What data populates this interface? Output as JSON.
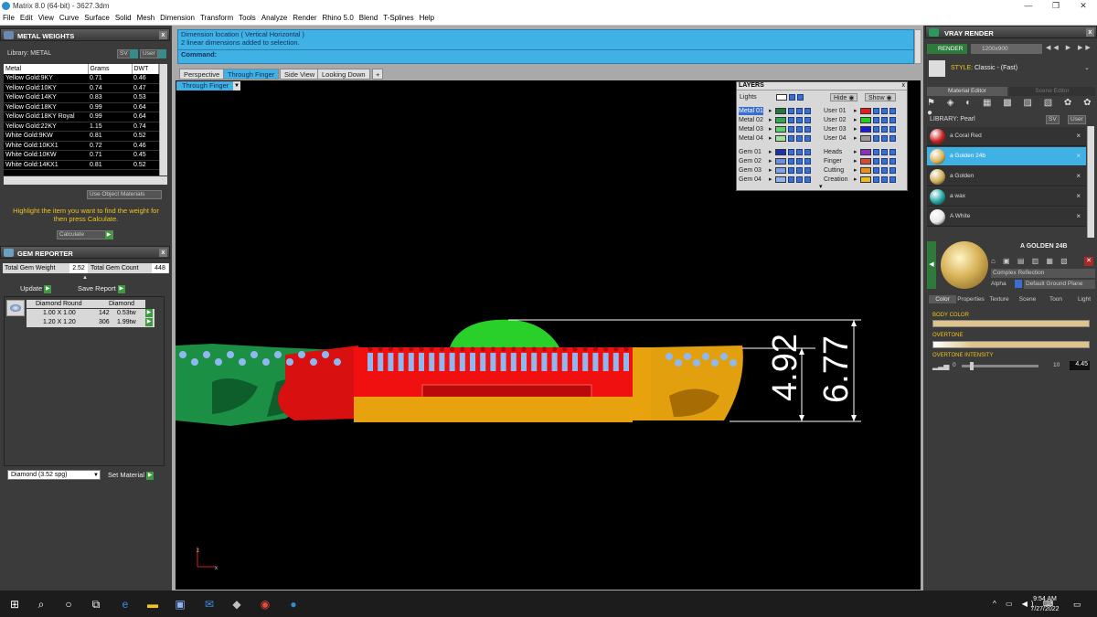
{
  "window": {
    "title": "Matrix 8.0 (64-bit) - 3627.3dm"
  },
  "menu": [
    "File",
    "Edit",
    "View",
    "Curve",
    "Surface",
    "Solid",
    "Mesh",
    "Dimension",
    "Transform",
    "Tools",
    "Analyze",
    "Render",
    "Rhino 5.0",
    "Blend",
    "T-Splines",
    "Help"
  ],
  "metal_weights": {
    "title": "METAL WEIGHTS",
    "library_label": "Library: METAL",
    "sv_label": "SV",
    "user_label": "User",
    "headers": [
      "Metal",
      "Grams",
      "DWT"
    ],
    "rows": [
      [
        "Yellow Gold:9KY",
        "0.71",
        "0.46"
      ],
      [
        "Yellow Gold:10KY",
        "0.74",
        "0.47"
      ],
      [
        "Yellow Gold:14KY",
        "0.83",
        "0.53"
      ],
      [
        "Yellow Gold:18KY",
        "0.99",
        "0.64"
      ],
      [
        "Yellow Gold:18KY Royal",
        "0.99",
        "0.64"
      ],
      [
        "Yellow Gold:22KY",
        "1.15",
        "0.74"
      ],
      [
        "White Gold:9KW",
        "0.81",
        "0.52"
      ],
      [
        "White Gold:10KX1",
        "0.72",
        "0.46"
      ],
      [
        "White Gold:10KW",
        "0.71",
        "0.45"
      ],
      [
        "White Gold:14KX1",
        "0.81",
        "0.52"
      ]
    ],
    "use_object_materials": "Use Object Materials",
    "hint": "Highlight the item you want to find the weight for then press Calculate.",
    "calculate": "Calculate"
  },
  "gem_reporter": {
    "title": "GEM REPORTER",
    "total_weight_label": "Total Gem Weight",
    "total_weight": "2.52",
    "total_count_label": "Total Gem Count",
    "total_count": "448",
    "update": "Update",
    "save_report": "Save Report",
    "headers": [
      "Diamond Round",
      "Diamond"
    ],
    "rows": [
      [
        "1.00 X 1.00",
        "142",
        "0.53tw"
      ],
      [
        "1.20 X 1.20",
        "306",
        "1.99tw"
      ]
    ],
    "material_select": "Diamond    (3.52 spg)",
    "set_material": "Set Material"
  },
  "command": {
    "line1": "Dimension location ( Vertical  Horizontal )",
    "line2": "2 linear dimensions added to selection.",
    "prompt": "Command:"
  },
  "view_tabs": [
    "Perspective",
    "Through Finger",
    "Side View",
    "Looking Down"
  ],
  "active_view_label": "Through Finger",
  "dimensions": {
    "inner": "4.92",
    "outer": "6.77"
  },
  "layers": {
    "title": "LAYERS",
    "lights": "Lights",
    "hide": "Hide",
    "show": "Show",
    "left": [
      {
        "name": "Metal 01",
        "color": "#1e7a3c"
      },
      {
        "name": "Metal 02",
        "color": "#2ea84c"
      },
      {
        "name": "Metal 03",
        "color": "#5cd06a"
      },
      {
        "name": "Metal 04",
        "color": "#9de29b"
      },
      {
        "name": "Gem 01",
        "color": "#1c2fb0"
      },
      {
        "name": "Gem 02",
        "color": "#6a8ee0"
      },
      {
        "name": "Gem 03",
        "color": "#7aa2e8"
      },
      {
        "name": "Gem 04",
        "color": "#8fb3ee"
      }
    ],
    "right": [
      {
        "name": "User 01",
        "color": "#e21d1d"
      },
      {
        "name": "User 02",
        "color": "#1fd01f"
      },
      {
        "name": "User 03",
        "color": "#1a1ad8"
      },
      {
        "name": "User 04",
        "color": "#9a9a9a"
      },
      {
        "name": "Heads",
        "color": "#8b2fc4"
      },
      {
        "name": "Finger",
        "color": "#d14a3a"
      },
      {
        "name": "Cutting",
        "color": "#e8921e"
      },
      {
        "name": "Creation",
        "color": "#f0b81e"
      }
    ]
  },
  "vray": {
    "title": "VRAY RENDER",
    "render": "RENDER",
    "resolution": "1200x900",
    "style_label": "STYLE:",
    "style_value": "Classic - (Fast)",
    "tabs": [
      "Material Editor",
      "Scene Editor"
    ],
    "library": "LIBRARY: Pearl",
    "sv_label": "SV",
    "user_label": "User",
    "materials": [
      {
        "name": "a Coral Red",
        "color": "#c81e1e",
        "selected": false
      },
      {
        "name": "a Golden 24b",
        "color": "#d8b45a",
        "selected": true
      },
      {
        "name": "a Golden",
        "color": "#d0ad55",
        "selected": false
      },
      {
        "name": "a wax",
        "color": "#1fa6a6",
        "selected": false
      },
      {
        "name": "A White",
        "color": "#e8e8e8",
        "selected": false
      }
    ],
    "preview_name": "A GOLDEN 24B",
    "reflection": "Complex Reflection",
    "alpha": "Alpha",
    "ground": "Default Ground Plane",
    "color_tabs": [
      "Color",
      "Properties",
      "Texture",
      "Scene",
      "Toon",
      "Light"
    ],
    "body_color": "BODY COLOR",
    "overtone": "OVERTONE",
    "overtone_intensity": "OVERTONE INTENSITY",
    "intensity_min": "0",
    "intensity_max": "10",
    "intensity_value": "4.45"
  },
  "taskbar": {
    "time": "9:54 AM",
    "date": "7/27/2022"
  }
}
